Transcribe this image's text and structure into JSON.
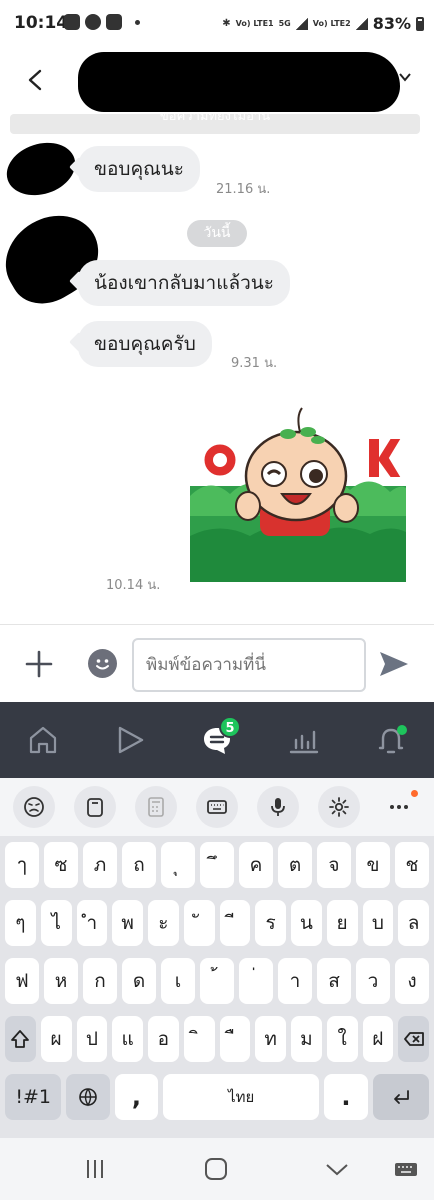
{
  "status_bar": {
    "time": "10:14",
    "sim1_label": "Vo) LTE1",
    "network": "5G",
    "sim2_label": "Vo) LTE2",
    "battery": "83%"
  },
  "header": {
    "hidden_banner": "ข้อความที่ยังไม่อ่าน"
  },
  "chat": {
    "messages": [
      {
        "text": "ขอบคุณนะ",
        "time": "21.16 น."
      },
      {
        "date_divider": "วันนี้"
      },
      {
        "text": "น้องเขากลับมาแล้วนะ",
        "time": ""
      },
      {
        "text": "ขอบคุณครับ",
        "time": "9.31 น."
      },
      {
        "sticker": "OK",
        "time": "10.14 น."
      }
    ]
  },
  "input": {
    "placeholder": "พิมพ์ข้อความที่นี่"
  },
  "bottom_nav": {
    "chat_badge": "5"
  },
  "keyboard": {
    "row1": [
      "ๅ",
      "ซ",
      "ภ",
      "ถ",
      "ุ",
      "ึ",
      "ค",
      "ต",
      "จ",
      "ข",
      "ช"
    ],
    "row2": [
      "ๆ",
      "ไ",
      "ำ",
      "พ",
      "ะ",
      "ั",
      "ี",
      "ร",
      "น",
      "ย",
      "บ",
      "ล"
    ],
    "row3": [
      "ฟ",
      "ห",
      "ก",
      "ด",
      "เ",
      "้",
      "่",
      "า",
      "ส",
      "ว",
      "ง"
    ],
    "row4": [
      "ผ",
      "ป",
      "แ",
      "อ",
      "ิ",
      "ื",
      "ท",
      "ม",
      "ใ",
      "ฝ"
    ],
    "symbols_label": "!#1",
    "comma_label": ",",
    "space_label": "ไทย",
    "period_label": "."
  },
  "colors": {
    "nav_bg": "#363a44",
    "badge_green": "#1ec45c",
    "bubble_bg": "#eeeff1"
  }
}
